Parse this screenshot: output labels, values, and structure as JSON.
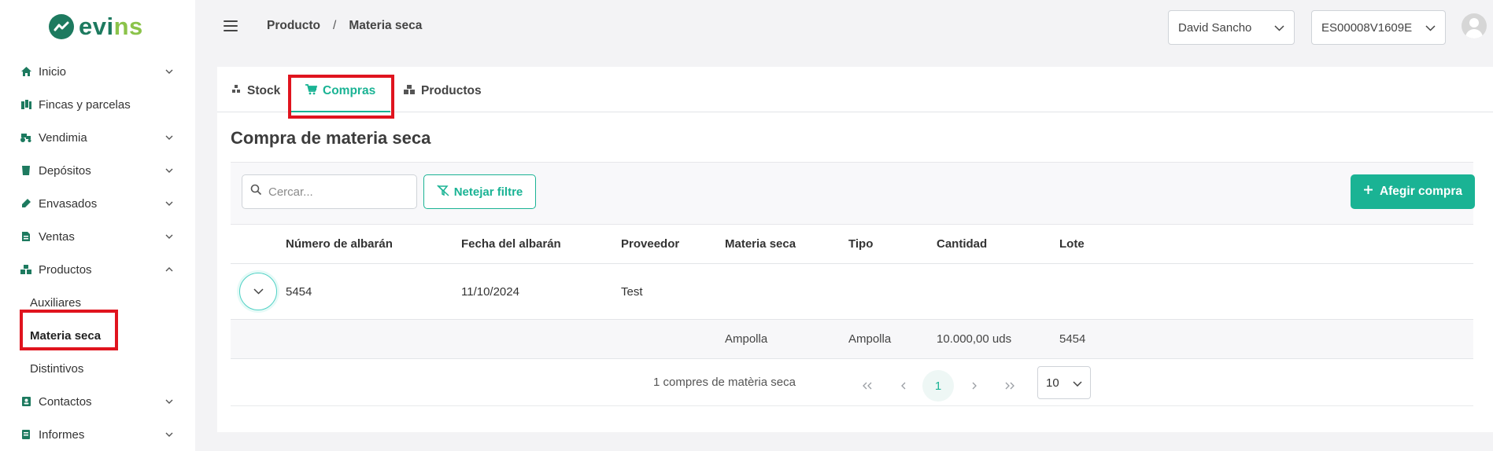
{
  "brand": {
    "name_main": "evi",
    "name_accent": "ns",
    "logo_icon": "trend-line-icon"
  },
  "sidebar": {
    "items": [
      {
        "label": "Inicio",
        "icon": "home-icon",
        "chevron": "down"
      },
      {
        "label": "Fincas y parcelas",
        "icon": "map-icon",
        "chevron": ""
      },
      {
        "label": "Vendimia",
        "icon": "tractor-icon",
        "chevron": "down"
      },
      {
        "label": "Depósitos",
        "icon": "tank-icon",
        "chevron": "down"
      },
      {
        "label": "Envasados",
        "icon": "bottle-icon",
        "chevron": "down"
      },
      {
        "label": "Ventas",
        "icon": "document-icon",
        "chevron": "down"
      },
      {
        "label": "Productos",
        "icon": "boxes-icon",
        "chevron": "up"
      }
    ],
    "sub_items": [
      {
        "label": "Auxiliares"
      },
      {
        "label": "Materia seca"
      },
      {
        "label": "Distintivos"
      }
    ],
    "items_after": [
      {
        "label": "Contactos",
        "icon": "contact-icon",
        "chevron": "down"
      },
      {
        "label": "Informes",
        "icon": "report-icon",
        "chevron": "down"
      }
    ]
  },
  "header": {
    "breadcrumb": [
      "Producto",
      "Materia seca"
    ],
    "breadcrumb_sep": "/",
    "user_select": "David Sancho",
    "code_select": "ES00008V1609E"
  },
  "tabs": [
    {
      "label": "Stock",
      "icon": "stock-icon"
    },
    {
      "label": "Compras",
      "icon": "cart-icon"
    },
    {
      "label": "Productos",
      "icon": "boxes-icon"
    }
  ],
  "main": {
    "title": "Compra de materia seca",
    "search_placeholder": "Cercar...",
    "clear_filter_label": "Netejar filtre",
    "add_button_label": "Afegir compra"
  },
  "table": {
    "columns": [
      "Número de albarán",
      "Fecha del albarán",
      "Proveedor",
      "Materia seca",
      "Tipo",
      "Cantidad",
      "Lote"
    ],
    "rows": [
      {
        "numero": "5454",
        "fecha": "11/10/2024",
        "proveedor": "Test"
      }
    ],
    "detail": {
      "materia": "Ampolla",
      "tipo": "Ampolla",
      "cantidad": "10.000,00 uds",
      "lote": "5454"
    }
  },
  "pagination": {
    "info": "1 compres de matèria seca",
    "current_page": "1",
    "per_page": "10"
  },
  "colors": {
    "accent": "#1ab394",
    "brand": "#1d7a5f",
    "highlight": "#e0141e"
  }
}
